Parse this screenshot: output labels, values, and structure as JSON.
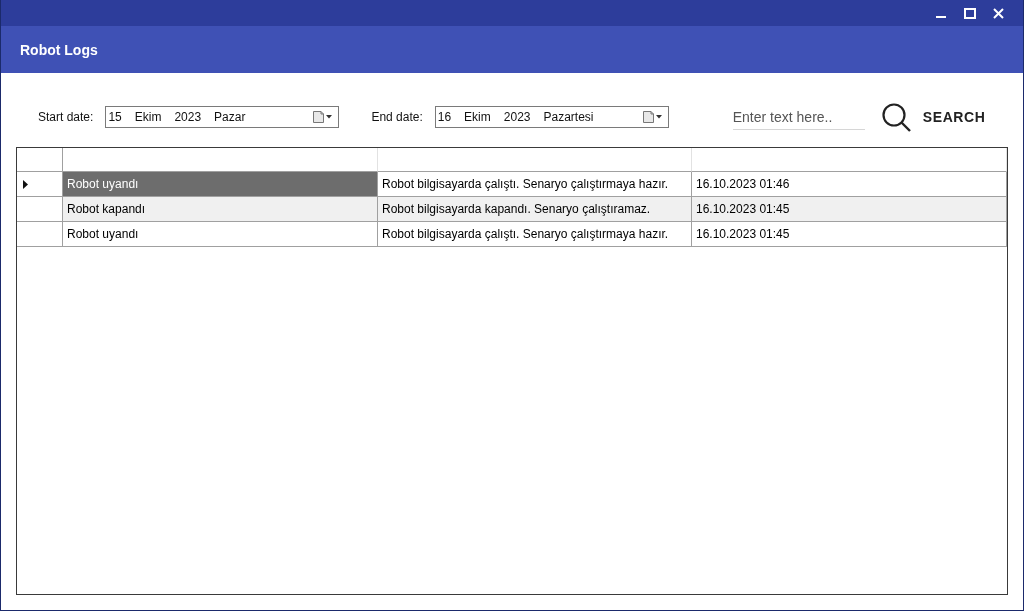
{
  "header": {
    "title": "Robot Logs"
  },
  "filters": {
    "date_fields": [
      {
        "label": "Start date:",
        "parts": [
          "15",
          "Ekim",
          "2023",
          "Pazar"
        ]
      },
      {
        "label": "End date:",
        "parts": [
          "16",
          "Ekim",
          "2023",
          "Pazartesi"
        ]
      }
    ],
    "search": {
      "placeholder": "Enter text here..",
      "button": "SEARCH"
    }
  },
  "table": {
    "rows": [
      {
        "current": true,
        "cells": [
          {
            "text": "Robot uyandı",
            "selected": true
          },
          {
            "text": "Robot bilgisayarda çalıştı. Senaryo çalıştırmaya hazır.",
            "selected": false
          },
          {
            "text": "16.10.2023 01:46",
            "selected": false
          }
        ]
      },
      {
        "current": false,
        "cells": [
          {
            "text": "Robot kapandı",
            "selected": false
          },
          {
            "text": "Robot bilgisayarda kapandı. Senaryo çalıştıramaz.",
            "selected": false
          },
          {
            "text": "16.10.2023 01:45",
            "selected": false
          }
        ]
      },
      {
        "current": false,
        "cells": [
          {
            "text": "Robot uyandı",
            "selected": false
          },
          {
            "text": "Robot bilgisayarda çalıştı. Senaryo çalıştırmaya hazır.",
            "selected": false
          },
          {
            "text": "16.10.2023 01:45",
            "selected": false
          }
        ]
      }
    ]
  }
}
